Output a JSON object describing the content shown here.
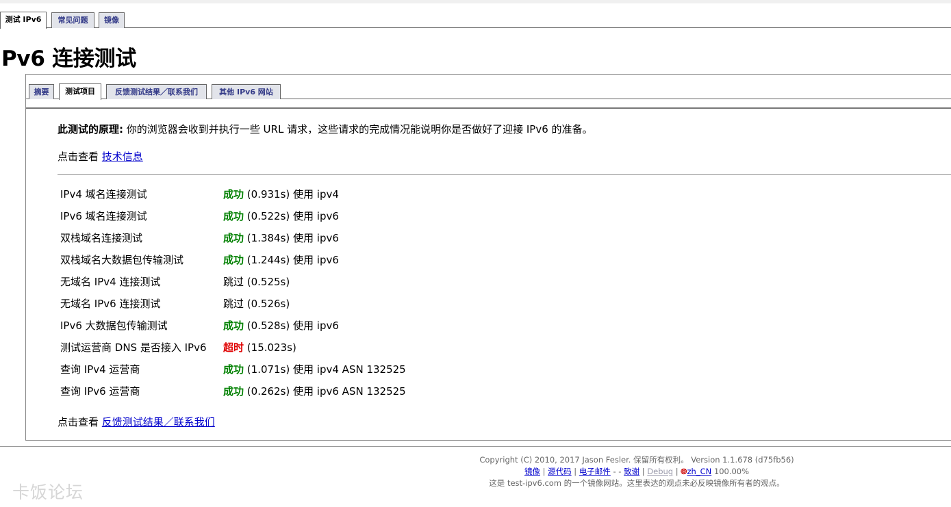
{
  "top_tabs": [
    {
      "label": "测试 IPv6",
      "active": true
    },
    {
      "label": "常见问题",
      "active": false
    },
    {
      "label": "镜像",
      "active": false
    }
  ],
  "page_title": "Pv6 连接测试",
  "sub_tabs": [
    {
      "label": "摘要",
      "active": false
    },
    {
      "label": "测试项目",
      "active": true
    },
    {
      "label": "反馈测试结果／联系我们",
      "active": false
    },
    {
      "label": "其他 IPv6 网站",
      "active": false
    }
  ],
  "intro": {
    "bold": "此测试的原理:",
    "text": "你的浏览器会收到并执行一些 URL 请求，这些请求的完成情况能说明你是否做好了迎接 IPv6 的准备。"
  },
  "tech_info": {
    "prefix": "点击查看",
    "link": "技术信息"
  },
  "results": [
    {
      "label": "IPv4 域名连接测试",
      "status": "成功",
      "status_type": "ok",
      "detail": "(0.931s) 使用 ipv4"
    },
    {
      "label": "IPv6 域名连接测试",
      "status": "成功",
      "status_type": "ok",
      "detail": "(0.522s) 使用 ipv6"
    },
    {
      "label": "双栈域名连接测试",
      "status": "成功",
      "status_type": "ok",
      "detail": "(1.384s) 使用 ipv6"
    },
    {
      "label": "双栈域名大数据包传输测试",
      "status": "成功",
      "status_type": "ok",
      "detail": "(1.244s) 使用 ipv6"
    },
    {
      "label": "无域名 IPv4 连接测试",
      "status": "",
      "status_type": "skip",
      "detail": "跳过 (0.525s)"
    },
    {
      "label": "无域名 IPv6 连接测试",
      "status": "",
      "status_type": "skip",
      "detail": "跳过 (0.526s)"
    },
    {
      "label": "IPv6 大数据包传输测试",
      "status": "成功",
      "status_type": "ok",
      "detail": "(0.528s) 使用 ipv6"
    },
    {
      "label": "测试运营商 DNS 是否接入 IPv6",
      "status": "超时",
      "status_type": "timeout",
      "detail": "(15.023s)"
    },
    {
      "label": "查询 IPv4 运营商",
      "status": "成功",
      "status_type": "ok",
      "detail": "(1.071s) 使用 ipv4 ASN 132525"
    },
    {
      "label": "查询 IPv6 运营商",
      "status": "成功",
      "status_type": "ok",
      "detail": "(0.262s) 使用 ipv6 ASN 132525"
    }
  ],
  "feedback": {
    "prefix": "点击查看",
    "link": "反馈测试结果／联系我们"
  },
  "footer": {
    "copyright": "Copyright (C) 2010, 2017 Jason Fesler. 保留所有权利。 Version 1.1.678 (d75fb56)",
    "links": {
      "mirror": "镜像",
      "source": "源代码",
      "email": "电子邮件",
      "thanks": "致谢",
      "debug": "Debug",
      "flag_icon": "language-flag-icon",
      "lang": "zh_CN",
      "percent": "100.00%"
    },
    "sep_pipe": "|",
    "sep_dash": "-",
    "mirror_note": "这是 test-ipv6.com 的一个镜像网站。这里表达的观点未必反映镜像所有者的观点。"
  },
  "watermark": "卡饭论坛",
  "colors": {
    "success": "#008000",
    "timeout": "#e00000",
    "link": "#0000cc",
    "tab_inactive_bg": "#e2e4ea",
    "tab_inactive_text": "#333a88"
  }
}
